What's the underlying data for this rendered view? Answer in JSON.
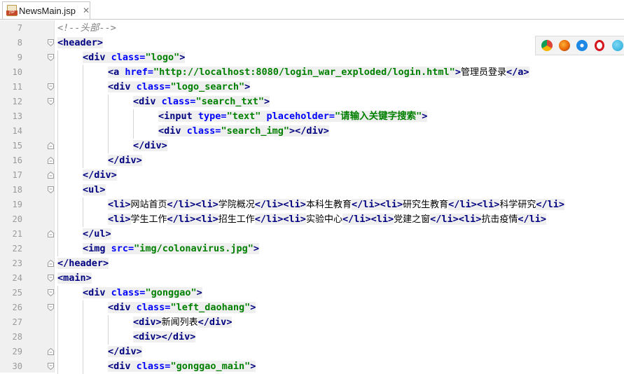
{
  "tab": {
    "filename": "NewsMain.jsp",
    "icon_label": "JSP"
  },
  "browser_icons": [
    "chrome-icon",
    "firefox-icon",
    "safari-icon",
    "opera-icon",
    "ie-icon"
  ],
  "lines": [
    {
      "n": "7",
      "indent": 0,
      "fold": "",
      "text": "<!--头部-->"
    },
    {
      "n": "8",
      "indent": 0,
      "fold": "open",
      "text": "<header>"
    },
    {
      "n": "9",
      "indent": 1,
      "fold": "open",
      "text": "<div class=\"logo\">"
    },
    {
      "n": "10",
      "indent": 2,
      "fold": "",
      "text": "<a href=\"http://localhost:8080/login_war_exploded/login.html\">管理员登录</a>"
    },
    {
      "n": "11",
      "indent": 2,
      "fold": "open",
      "text": "<div class=\"logo_search\">"
    },
    {
      "n": "12",
      "indent": 3,
      "fold": "open",
      "text": "<div class=\"search_txt\">"
    },
    {
      "n": "13",
      "indent": 4,
      "fold": "",
      "text": "<input type=\"text\" placeholder=\"请输入关键字搜索\">"
    },
    {
      "n": "14",
      "indent": 4,
      "fold": "",
      "text": "<div class=\"search_img\"></div>"
    },
    {
      "n": "15",
      "indent": 3,
      "fold": "close",
      "text": "</div>"
    },
    {
      "n": "16",
      "indent": 2,
      "fold": "close",
      "text": "</div>"
    },
    {
      "n": "17",
      "indent": 1,
      "fold": "close",
      "text": "</div>"
    },
    {
      "n": "18",
      "indent": 1,
      "fold": "open",
      "text": "<ul>"
    },
    {
      "n": "19",
      "indent": 2,
      "fold": "",
      "text": "<li>网站首页</li><li>学院概况</li><li>本科生教育</li><li>研究生教育</li><li>科学研究</li>"
    },
    {
      "n": "20",
      "indent": 2,
      "fold": "",
      "text": "<li>学生工作</li><li>招生工作</li><li>实验中心</li><li>党建之窗</li><li>抗击疫情</li>"
    },
    {
      "n": "21",
      "indent": 1,
      "fold": "close",
      "text": "</ul>"
    },
    {
      "n": "22",
      "indent": 1,
      "fold": "",
      "text": "<img src=\"img/colonavirus.jpg\">"
    },
    {
      "n": "23",
      "indent": 0,
      "fold": "close",
      "text": "</header>"
    },
    {
      "n": "24",
      "indent": 0,
      "fold": "open",
      "text": "<main>"
    },
    {
      "n": "25",
      "indent": 1,
      "fold": "open",
      "text": "<div class=\"gonggao\">"
    },
    {
      "n": "26",
      "indent": 2,
      "fold": "open",
      "text": "<div class=\"left_daohang\">"
    },
    {
      "n": "27",
      "indent": 3,
      "fold": "",
      "text": "<div>新闻列表</div>"
    },
    {
      "n": "28",
      "indent": 3,
      "fold": "",
      "text": "<div></div>"
    },
    {
      "n": "29",
      "indent": 2,
      "fold": "close",
      "text": "</div>"
    },
    {
      "n": "30",
      "indent": 2,
      "fold": "open",
      "text": "<div class=\"gonggao_main\">"
    }
  ]
}
